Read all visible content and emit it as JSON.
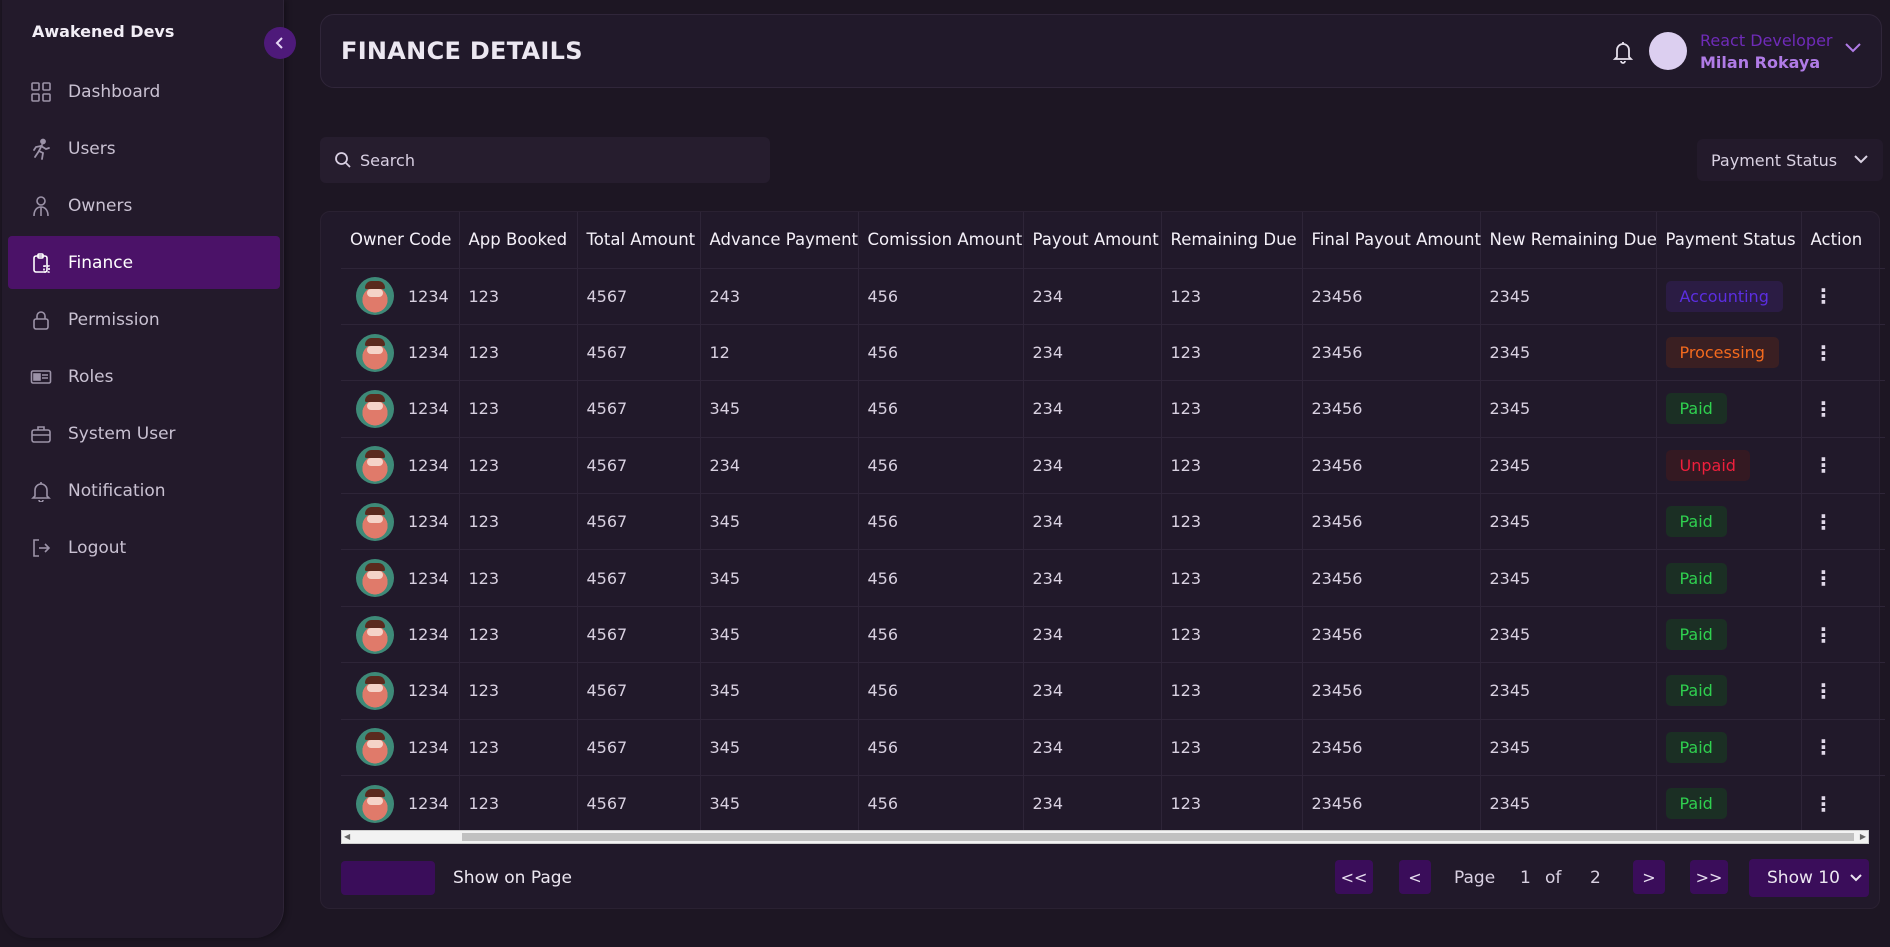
{
  "brand": "Awakened Devs",
  "sidebar": {
    "items": [
      {
        "label": "Dashboard",
        "icon": "dashboard-icon"
      },
      {
        "label": "Users",
        "icon": "running-person-icon"
      },
      {
        "label": "Owners",
        "icon": "owner-person-icon"
      },
      {
        "label": "Finance",
        "icon": "finance-clipboard-icon",
        "active": true
      },
      {
        "label": "Permission",
        "icon": "lock-icon"
      },
      {
        "label": "Roles",
        "icon": "id-card-icon"
      },
      {
        "label": "System User",
        "icon": "briefcase-icon"
      },
      {
        "label": "Notification",
        "icon": "bell-icon"
      },
      {
        "label": "Logout",
        "icon": "logout-icon"
      }
    ]
  },
  "header": {
    "title": "FINANCE DETAILS",
    "user_role": "React Developer",
    "user_name": "Milan Rokaya"
  },
  "search": {
    "placeholder": "Search"
  },
  "filter": {
    "label": "Payment Status"
  },
  "table": {
    "columns": [
      "Owner Code",
      "App Booked",
      "Total Amount",
      "Advance Payment",
      "Comission Amount",
      "Payout Amount",
      "Remaining Due",
      "Final Payout Amount",
      "New Remaining Due",
      "Payment Status",
      "Action"
    ],
    "rows": [
      {
        "owner_code": "1234",
        "app_booked": "123",
        "total": "4567",
        "advance": "243",
        "comission": "456",
        "payout": "234",
        "remaining": "123",
        "final_payout": "23456",
        "new_remaining": "2345",
        "status": "Accounting"
      },
      {
        "owner_code": "1234",
        "app_booked": "123",
        "total": "4567",
        "advance": "12",
        "comission": "456",
        "payout": "234",
        "remaining": "123",
        "final_payout": "23456",
        "new_remaining": "2345",
        "status": "Processing"
      },
      {
        "owner_code": "1234",
        "app_booked": "123",
        "total": "4567",
        "advance": "345",
        "comission": "456",
        "payout": "234",
        "remaining": "123",
        "final_payout": "23456",
        "new_remaining": "2345",
        "status": "Paid"
      },
      {
        "owner_code": "1234",
        "app_booked": "123",
        "total": "4567",
        "advance": "234",
        "comission": "456",
        "payout": "234",
        "remaining": "123",
        "final_payout": "23456",
        "new_remaining": "2345",
        "status": "Unpaid"
      },
      {
        "owner_code": "1234",
        "app_booked": "123",
        "total": "4567",
        "advance": "345",
        "comission": "456",
        "payout": "234",
        "remaining": "123",
        "final_payout": "23456",
        "new_remaining": "2345",
        "status": "Paid"
      },
      {
        "owner_code": "1234",
        "app_booked": "123",
        "total": "4567",
        "advance": "345",
        "comission": "456",
        "payout": "234",
        "remaining": "123",
        "final_payout": "23456",
        "new_remaining": "2345",
        "status": "Paid"
      },
      {
        "owner_code": "1234",
        "app_booked": "123",
        "total": "4567",
        "advance": "345",
        "comission": "456",
        "payout": "234",
        "remaining": "123",
        "final_payout": "23456",
        "new_remaining": "2345",
        "status": "Paid"
      },
      {
        "owner_code": "1234",
        "app_booked": "123",
        "total": "4567",
        "advance": "345",
        "comission": "456",
        "payout": "234",
        "remaining": "123",
        "final_payout": "23456",
        "new_remaining": "2345",
        "status": "Paid"
      },
      {
        "owner_code": "1234",
        "app_booked": "123",
        "total": "4567",
        "advance": "345",
        "comission": "456",
        "payout": "234",
        "remaining": "123",
        "final_payout": "23456",
        "new_remaining": "2345",
        "status": "Paid"
      },
      {
        "owner_code": "1234",
        "app_booked": "123",
        "total": "4567",
        "advance": "345",
        "comission": "456",
        "payout": "234",
        "remaining": "123",
        "final_payout": "23456",
        "new_remaining": "2345",
        "status": "Paid"
      }
    ]
  },
  "status_colors": {
    "Accounting": {
      "fg": "#5b2ee0",
      "bg": "#2b1c44"
    },
    "Processing": {
      "fg": "#f36a1e",
      "bg": "#3a1f22"
    },
    "Paid": {
      "fg": "#2fd04f",
      "bg": "#1b2f24"
    },
    "Unpaid": {
      "fg": "#ee1f3c",
      "bg": "#341922"
    }
  },
  "footer": {
    "show_on_page": "Show on Page",
    "first": "<<",
    "prev": "<",
    "page_label": "Page",
    "current_page": "1",
    "of_label": "of",
    "total_pages": "2",
    "next": ">",
    "last": ">>",
    "show_select": "Show 10"
  },
  "colors": {
    "accent": "#4b1268",
    "background": "#1d1623"
  }
}
